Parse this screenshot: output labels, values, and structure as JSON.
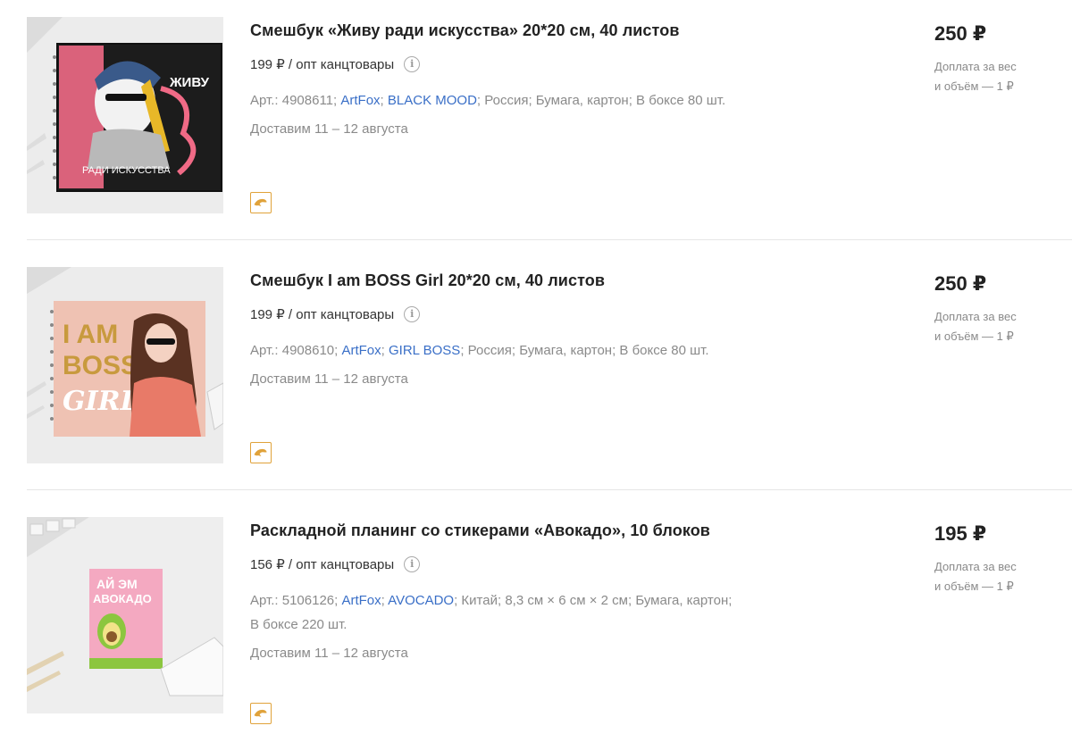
{
  "products": [
    {
      "title": "Смешбук «Живу ради искусства» 20*20 см, 40 листов",
      "opt_price": "199 ₽ / опт канцтовары",
      "article": "Арт.: 4908611;",
      "brand": "ArtFox",
      "series": "BLACK MOOD",
      "country": "Россия;",
      "size": "",
      "material": "Бумага, картон;",
      "box": "В боксе 80 шт.",
      "delivery": "Доставим 11 – 12 августа",
      "price": "250 ₽",
      "surcharge_line1": "Доплата за вес",
      "surcharge_line2": "и объём — 1 ₽",
      "cover_text_top": "ЖИВУ",
      "cover_text_bottom": "РАДИ ИСКУССТВА",
      "cover_colors": {
        "pink": "#f06a86",
        "black": "#1c1c1c"
      }
    },
    {
      "title": "Смешбук I am BOSS Girl 20*20 см, 40 листов",
      "opt_price": "199 ₽ / опт канцтовары",
      "article": "Арт.: 4908610;",
      "brand": "ArtFox",
      "series": "GIRL BOSS",
      "country": "Россия;",
      "size": "",
      "material": "Бумага, картон;",
      "box": "В боксе 80 шт.",
      "delivery": "Доставим 11 – 12 августа",
      "price": "250 ₽",
      "surcharge_line1": "Доплата за вес",
      "surcharge_line2": "и объём — 1 ₽",
      "cover_text_top": "I AM",
      "cover_text_mid": "BOSS",
      "cover_text_bottom": "GIRL",
      "cover_colors": {
        "peach": "#efc2b3",
        "gold": "#c89a3e"
      }
    },
    {
      "title": "Раскладной планинг со стикерами «Авокадо», 10 блоков",
      "opt_price": "156 ₽ / опт канцтовары",
      "article": "Арт.: 5106126;",
      "brand": "ArtFox",
      "series": "AVOCADO",
      "country": "Китай;",
      "size": "8,3 см × 6 см × 2 см;",
      "material": "Бумага, картон;",
      "box": "В боксе 220 шт.",
      "delivery": "Доставим 11 – 12 августа",
      "price": "195 ₽",
      "surcharge_line1": "Доплата за вес",
      "surcharge_line2": "и объём — 1 ₽",
      "cover_text_top": "АЙ ЭМ",
      "cover_text_bottom": "АВОКАДО",
      "cover_colors": {
        "pink": "#f4a9c1",
        "green": "#8cc63f"
      }
    }
  ],
  "ui": {
    "info_icon": "info-icon",
    "badge_icon": "dolphin-icon",
    "link_color": "#3a6fc7",
    "badge_color": "#e0a23a"
  }
}
